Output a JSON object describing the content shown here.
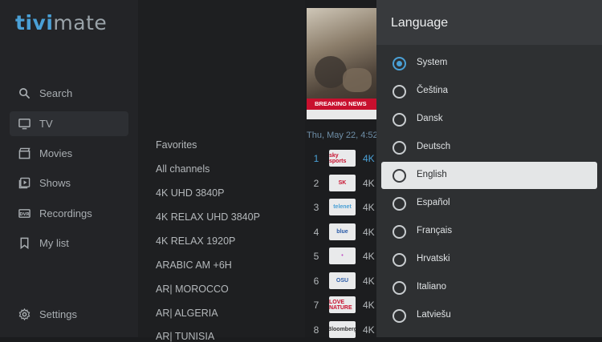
{
  "app": {
    "logo_part1": "tivi",
    "logo_part2": "mate"
  },
  "nav": {
    "items": [
      {
        "label": "Search",
        "icon": "search-icon"
      },
      {
        "label": "TV",
        "icon": "tv-icon"
      },
      {
        "label": "Movies",
        "icon": "movie-icon"
      },
      {
        "label": "Shows",
        "icon": "shows-icon"
      },
      {
        "label": "Recordings",
        "icon": "recordings-icon"
      },
      {
        "label": "My list",
        "icon": "bookmark-icon"
      }
    ],
    "active": "TV",
    "settings_label": "Settings"
  },
  "groups": [
    "Favorites",
    "All channels",
    "4K UHD 3840P",
    "4K RELAX UHD 3840P",
    "4K RELAX 1920P",
    "ARABIC AM +6H",
    "AR| MOROCCO",
    "AR| ALGERIA",
    "AR| TUNISIA"
  ],
  "preview": {
    "banner": "BREAKING NEWS"
  },
  "channels": {
    "date_label": "Thu, May 22, 4:52",
    "rows": [
      {
        "number": "1",
        "name": "4K",
        "logo": "sky sports",
        "logo_color": "#c8102e"
      },
      {
        "number": "2",
        "name": "4K",
        "logo": "SK",
        "logo_color": "#c8102e"
      },
      {
        "number": "3",
        "name": "4K",
        "logo": "telenet",
        "logo_color": "#4aa0d6"
      },
      {
        "number": "4",
        "name": "4K",
        "logo": "blue",
        "logo_color": "#2a5ba8"
      },
      {
        "number": "5",
        "name": "4K",
        "logo": "•",
        "logo_color": "#c04ac4"
      },
      {
        "number": "6",
        "name": "4K",
        "logo": "OSU",
        "logo_color": "#2a5ba8"
      },
      {
        "number": "7",
        "name": "4K",
        "logo": "LOVE NATURE",
        "logo_color": "#c8102e"
      },
      {
        "number": "8",
        "name": "4K",
        "logo": "Bloomberg",
        "logo_color": "#333333"
      }
    ]
  },
  "language_dialog": {
    "title": "Language",
    "selected": "System",
    "focused": "English",
    "options": [
      "System",
      "Čeština",
      "Dansk",
      "Deutsch",
      "English",
      "Español",
      "Français",
      "Hrvatski",
      "Italiano",
      "Latviešu"
    ]
  }
}
